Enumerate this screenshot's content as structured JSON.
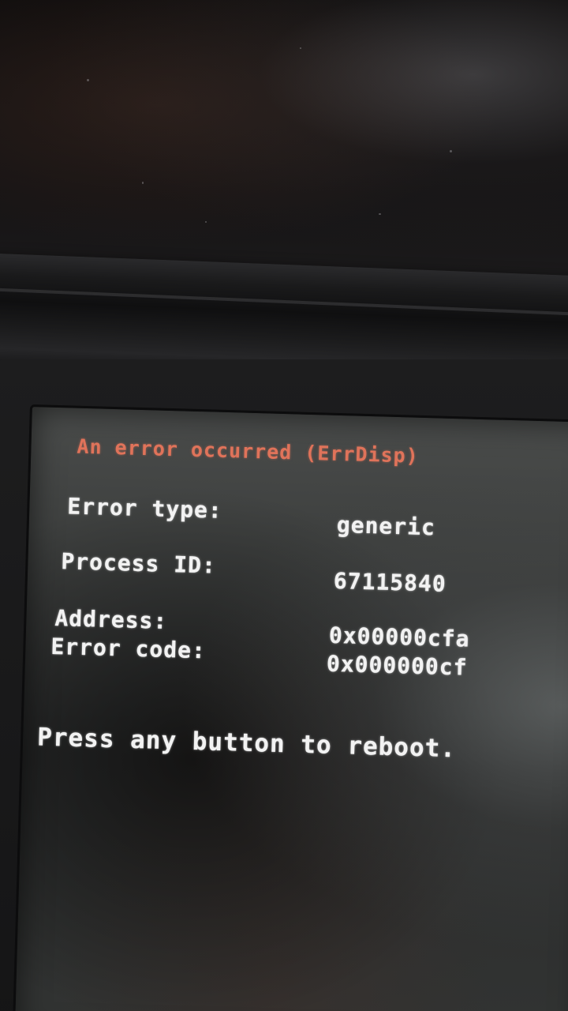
{
  "error_screen": {
    "title": "An error occurred (ErrDisp)",
    "rows": [
      {
        "label": "Error type:",
        "value": "generic"
      },
      {
        "label": "Process ID:",
        "value": "67115840"
      },
      {
        "label": "Address:",
        "value": "0x00000cfa"
      },
      {
        "label": "Error code:",
        "value": "0x000000cf"
      }
    ],
    "footer": "Press any button to reboot."
  },
  "colors": {
    "title": "#e0735a",
    "text": "#f2f2f2",
    "screen": "#3e403f"
  }
}
